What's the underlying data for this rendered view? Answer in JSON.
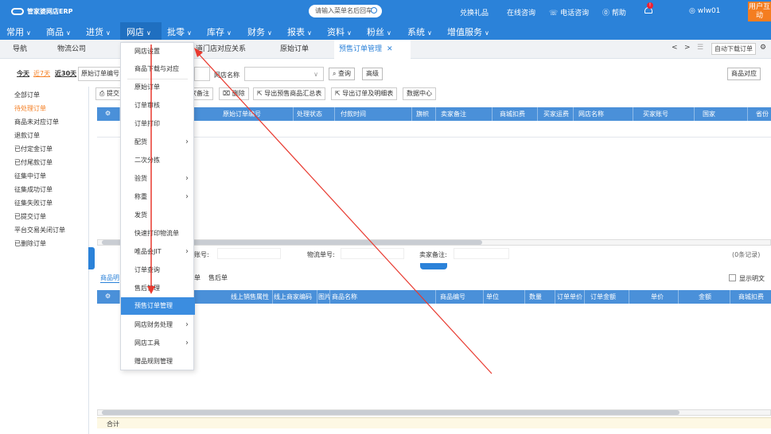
{
  "topbar": {
    "logo_text": "管家婆网店ERP",
    "search_placeholder": "请输入菜单名后回车",
    "links": [
      "兑换礼品",
      "在线咨询",
      "电话咨询",
      "帮助"
    ],
    "notify_badge": "!",
    "user": "wlw01",
    "corner_chip": "用户互动"
  },
  "main_menu": [
    {
      "label": "常用",
      "icon": "chevron-down-icon"
    },
    {
      "label": "商品",
      "icon": "chevron-down-icon"
    },
    {
      "label": "进货",
      "icon": "chevron-down-icon"
    },
    {
      "label": "网店",
      "icon": "chevron-down-icon"
    },
    {
      "label": "批零",
      "icon": "chevron-down-icon"
    },
    {
      "label": "库存",
      "icon": "chevron-down-icon"
    },
    {
      "label": "财务",
      "icon": "chevron-down-icon"
    },
    {
      "label": "报表",
      "icon": "chevron-down-icon"
    },
    {
      "label": "资料",
      "icon": "chevron-down-icon"
    },
    {
      "label": "粉丝",
      "icon": "chevron-down-icon"
    },
    {
      "label": "系统",
      "icon": "chevron-down-icon"
    },
    {
      "label": "增值服务",
      "icon": "chevron-down-icon"
    }
  ],
  "tabs": [
    {
      "label": "导航"
    },
    {
      "label": "物流公司"
    },
    {
      "label": "道门店对应关系"
    },
    {
      "label": "原始订单"
    },
    {
      "label": "预售订单管理",
      "active": true
    }
  ],
  "tabs_right": {
    "auto_download": "自动下载订单"
  },
  "filter": {
    "today": "今天",
    "last7": "近7天",
    "last30": "近30天",
    "order_no_label": "原始订单编号",
    "shop_name_label": "网店名称",
    "query": "查询",
    "advanced": "高级",
    "product_map": "商品对应"
  },
  "left_nav": {
    "items": [
      "全部订单",
      "待处理订单",
      "商品未对应订单",
      "退款订单",
      "已付定金订单",
      "已付尾款订单",
      "征集中订单",
      "征集成功订单",
      "征集失败订单",
      "已提交订单",
      "平台交易关闭订单",
      "已删除订单"
    ],
    "active_index": 1
  },
  "toolbar": {
    "submit": "提交",
    "seller_note": "家备注",
    "delete": "删除",
    "export_summary": "导出预售商品汇总表",
    "export_detail": "导出订单及明细表",
    "data_center": "数据中心"
  },
  "grid": {
    "columns": [
      "原始订单编号",
      "处理状态",
      "付款时间",
      "旗帜",
      "卖家备注",
      "商城扣费",
      "买家运费",
      "网店名称",
      "买家账号",
      "国家",
      "省份"
    ]
  },
  "mid_panel": {
    "buyer_account": "家账号:",
    "tracking_no": "物流单号:",
    "seller_note": "卖家备注:",
    "records": "(0条记录)"
  },
  "bottom_tabs": {
    "first": "商品明",
    "items": [
      "单",
      "售后单"
    ],
    "show_detail": "显示明文"
  },
  "bottom_grid": {
    "columns": [
      "线上销售属性",
      "线上商家编码",
      "图片",
      "商品名称",
      "商品编号",
      "单位",
      "数量",
      "订单单价",
      "订单金额",
      "单价",
      "金额",
      "商城扣费"
    ]
  },
  "footer": {
    "total_label": "合计"
  },
  "dropdown": [
    {
      "label": "网店设置"
    },
    {
      "label": "商品下载与对应"
    },
    {
      "label": "原始订单"
    },
    {
      "label": "订单审核"
    },
    {
      "label": "订单打印"
    },
    {
      "label": "配货",
      "submenu": true
    },
    {
      "label": "二次分拣"
    },
    {
      "label": "验货",
      "submenu": true
    },
    {
      "label": "称重",
      "submenu": true
    },
    {
      "label": "发货"
    },
    {
      "label": "快速打印物流单"
    },
    {
      "label": "唯品会JIT",
      "submenu": true
    },
    {
      "label": "订单查询"
    },
    {
      "label": "售后管理"
    },
    {
      "label": "预售订单管理",
      "highlighted": true
    },
    {
      "label": "网店财务处理",
      "submenu": true
    },
    {
      "label": "网店工具",
      "submenu": true
    },
    {
      "label": "赠品规则管理"
    }
  ],
  "colors": {
    "brand": "#2b82d9",
    "accent": "#f47d20",
    "highlight": "#3b8de0",
    "annotation": "#e8392f"
  }
}
